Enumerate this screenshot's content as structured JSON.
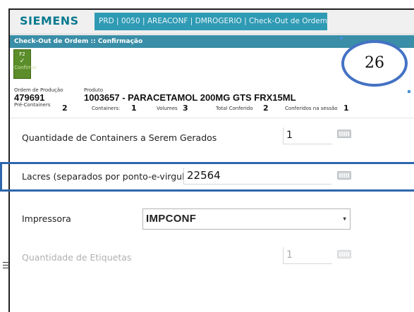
{
  "header": {
    "brand": "SIEMENS",
    "context": "PRD | 0050 | AREACONF | DMROGERIO | Check-Out de Ordem"
  },
  "page": {
    "title": "Check-Out de Ordem :: Confirmação"
  },
  "toolbar": {
    "confirm_key": "F2",
    "confirm_check": "✓",
    "confirm_label": "Confirme"
  },
  "annotation": {
    "number": "26"
  },
  "order": {
    "ordem_label": "Ordem de Produção",
    "ordem_value": "479691",
    "produto_label": "Produto",
    "produto_value": "1003657 - PARACETAMOL 200MG GTS FRX15ML",
    "pre_containers_label": "Pré-Containers",
    "pre_containers_value": "2",
    "containers_label": "Containers:",
    "containers_value": "1",
    "volumes_label": "Volumes",
    "volumes_value": "3",
    "total_label": "Total Conferido",
    "total_value": "2",
    "sessao_label": "Conferidos na sessão",
    "sessao_value": "1"
  },
  "form": {
    "qtd_containers_label": "Quantidade de Containers a Serem Gerados",
    "qtd_containers_value": "1",
    "lacres_label": "Lacres (separados por ponto-e-virgula)",
    "lacres_value": "22564",
    "impressora_label": "Impressora",
    "impressora_value": "IMPCONF",
    "qtd_etiquetas_label": "Quantidade de Etiquetas",
    "qtd_etiquetas_value": "1"
  },
  "icons": [
    "keyboard-icon",
    "check-icon",
    "chevron-down-icon",
    "menu-icon"
  ],
  "colors": {
    "brand": "#0a7a8f",
    "context_bar": "#2f9ab4",
    "title_bar": "#3a8ea7",
    "confirm_button": "#5b8d2a",
    "highlight": "#2e66ad",
    "annotation_ring": "#4472c4"
  }
}
